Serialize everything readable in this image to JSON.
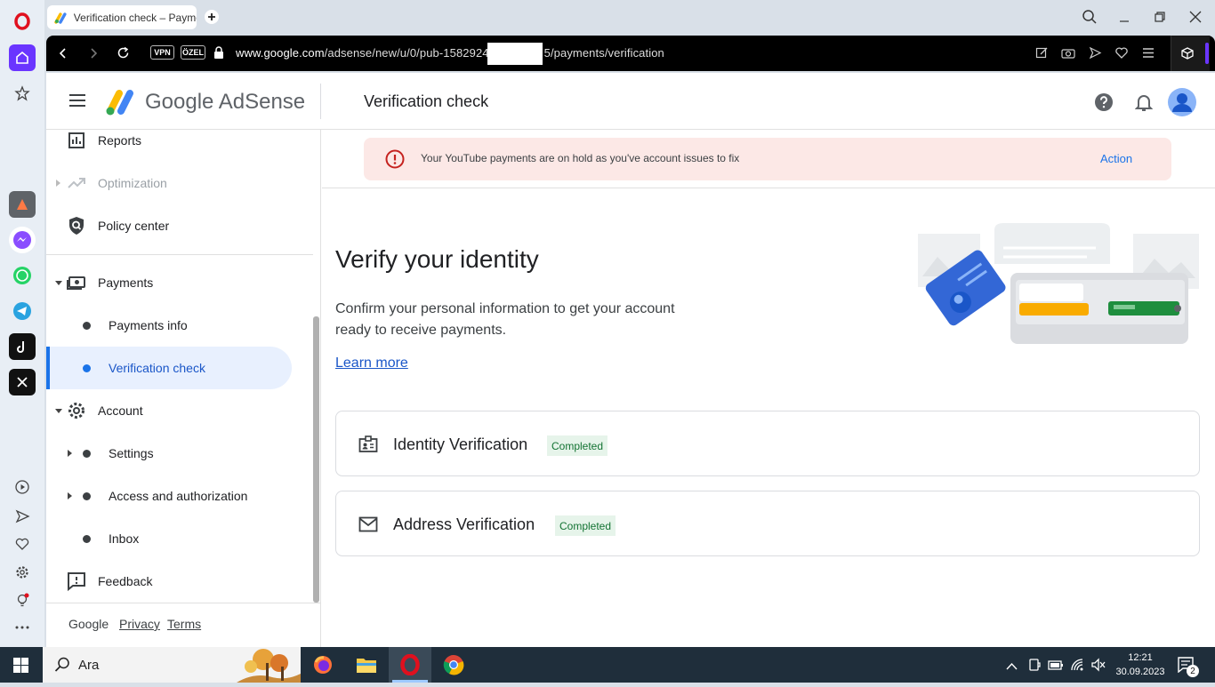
{
  "browser": {
    "tab_title": "Verification check – Payme",
    "url_host": "www.google.com",
    "url_path_1": "/adsense/new/u/0/pub-1582924",
    "url_path_2": "5/payments/verification",
    "vpn_label": "VPN",
    "private_label": "ÖZEL"
  },
  "header": {
    "brand": "Google AdSense",
    "page_title": "Verification check"
  },
  "nav": {
    "reports": "Reports",
    "optimization": "Optimization",
    "policy_center": "Policy center",
    "payments": "Payments",
    "payments_info": "Payments info",
    "verification_check": "Verification check",
    "account": "Account",
    "settings": "Settings",
    "access": "Access and authorization",
    "inbox": "Inbox",
    "feedback": "Feedback"
  },
  "footer": {
    "google": "Google",
    "privacy": "Privacy",
    "terms": "Terms"
  },
  "alert": {
    "text": "Your YouTube payments are on hold as you've account issues to fix",
    "action": "Action"
  },
  "main": {
    "title": "Verify your identity",
    "description_1": "Confirm your personal information to get your account",
    "description_2": "ready to receive payments.",
    "learn_more": "Learn more",
    "cards": [
      {
        "title": "Identity Verification",
        "status": "Completed"
      },
      {
        "title": "Address Verification",
        "status": "Completed"
      }
    ]
  },
  "taskbar": {
    "search_label": "Ara",
    "time": "12:21",
    "date": "30.09.2023",
    "notif_count": "2"
  },
  "colors": {
    "accent": "#1a73e8",
    "alert_bg": "#fce8e6",
    "alert_icon": "#c5221f",
    "badge_bg": "#e6f4ea",
    "badge_text": "#137333"
  }
}
